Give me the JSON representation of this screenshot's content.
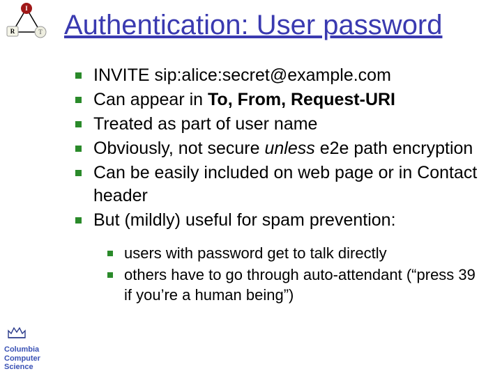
{
  "title": "Authentication: User password",
  "bullets": {
    "b1": "INVITE sip:alice:secret@example.com",
    "b2_pre": "Can appear in ",
    "b2_bold": "To, From, Request-URI",
    "b3": "Treated as part of user name",
    "b4_pre": "Obviously, not secure ",
    "b4_ital": "unless",
    "b4_post": " e2e path encryption",
    "b5": "Can be easily included on web page or in Contact header",
    "b6": "But (mildly) useful for spam prevention:"
  },
  "sub": {
    "s1": "users with password get to talk directly",
    "s2": "others have to go through auto-attendant (“press 39 if you’re a human being”)"
  },
  "irt": {
    "i": "I",
    "r": "R",
    "t": "T"
  },
  "footer": {
    "l1": "Columbia",
    "l2": "Computer",
    "l3": "Science"
  }
}
